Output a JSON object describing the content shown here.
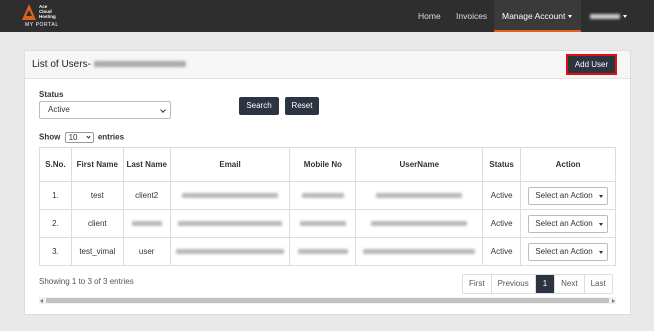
{
  "logo": {
    "line1": "Ace",
    "line2": "Cloud",
    "line3": "Hosting",
    "portal": "MY PORTAL"
  },
  "nav": {
    "home": "Home",
    "invoices": "Invoices",
    "manage": "Manage Account"
  },
  "panel": {
    "title": "List of Users-",
    "add_user": "Add User"
  },
  "filters": {
    "status_label": "Status",
    "status_value": "Active",
    "search": "Search",
    "reset": "Reset"
  },
  "entries": {
    "show": "Show",
    "value": "10",
    "suffix": "entries"
  },
  "table": {
    "headers": [
      "S.No.",
      "First Name",
      "Last Name",
      "Email",
      "Mobile No",
      "UserName",
      "Status",
      "Action"
    ],
    "rows": [
      {
        "sno": "1.",
        "first": "test",
        "last": "client2",
        "status": "Active",
        "action": "Select an Action"
      },
      {
        "sno": "2.",
        "first": "client",
        "last": "",
        "status": "Active",
        "action": "Select an Action"
      },
      {
        "sno": "3.",
        "first": "test_vimal",
        "last": "user",
        "status": "Active",
        "action": "Select an Action"
      }
    ]
  },
  "footer": {
    "info": "Showing 1 to 3 of 3 entries"
  },
  "pagination": {
    "first": "First",
    "previous": "Previous",
    "current": "1",
    "next": "Next",
    "last": "Last"
  },
  "colors": {
    "navbar": "#2e2e2e",
    "accent": "#e0601f",
    "button": "#2b3440",
    "highlight": "#e01010"
  }
}
